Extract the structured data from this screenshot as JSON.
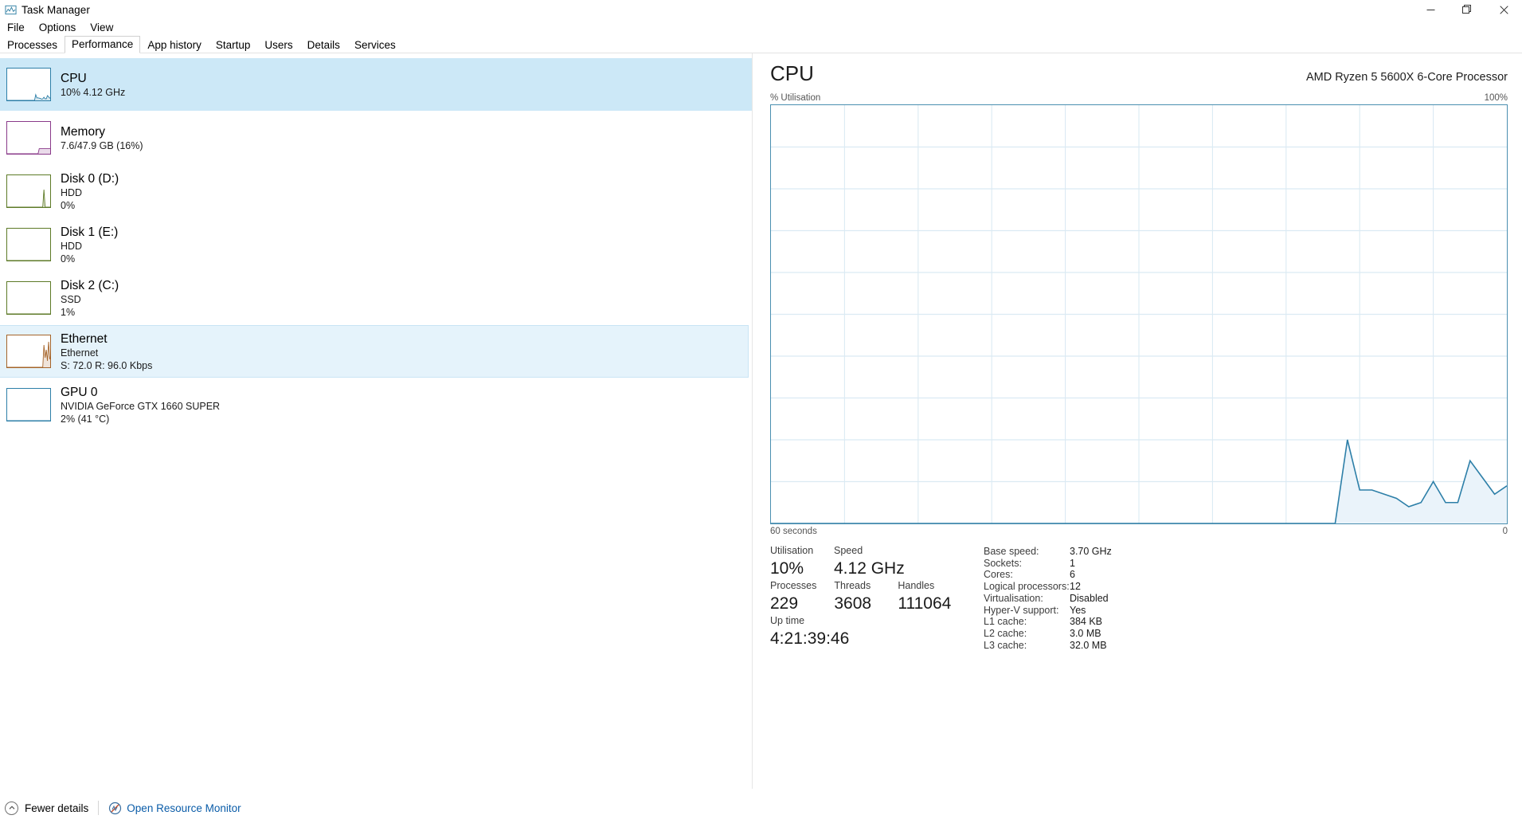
{
  "window": {
    "title": "Task Manager",
    "icon": "task-manager-icon",
    "minimize": "—",
    "restore": "❐",
    "close": "✕"
  },
  "menu": [
    "File",
    "Options",
    "View"
  ],
  "tabs": [
    {
      "label": "Processes",
      "active": false
    },
    {
      "label": "Performance",
      "active": true
    },
    {
      "label": "App history",
      "active": false
    },
    {
      "label": "Startup",
      "active": false
    },
    {
      "label": "Users",
      "active": false
    },
    {
      "label": "Details",
      "active": false
    },
    {
      "label": "Services",
      "active": false
    }
  ],
  "sidebar": {
    "items": [
      {
        "name": "cpu",
        "title": "CPU",
        "sub1": "10%  4.12 GHz",
        "sub2": "",
        "state": "selected",
        "color": "#2d7fa8"
      },
      {
        "name": "memory",
        "title": "Memory",
        "sub1": "7.6/47.9 GB (16%)",
        "sub2": "",
        "state": "normal",
        "color": "#8a3a8a"
      },
      {
        "name": "disk-0",
        "title": "Disk 0 (D:)",
        "sub1": "HDD",
        "sub2": "0%",
        "state": "normal",
        "color": "#5d7a27"
      },
      {
        "name": "disk-1",
        "title": "Disk 1 (E:)",
        "sub1": "HDD",
        "sub2": "0%",
        "state": "normal",
        "color": "#5d7a27"
      },
      {
        "name": "disk-2",
        "title": "Disk 2 (C:)",
        "sub1": "SSD",
        "sub2": "1%",
        "state": "normal",
        "color": "#5d7a27"
      },
      {
        "name": "ethernet",
        "title": "Ethernet",
        "sub1": "Ethernet",
        "sub2": "S: 72.0 R: 96.0 Kbps",
        "state": "hover",
        "color": "#a5642a"
      },
      {
        "name": "gpu-0",
        "title": "GPU 0",
        "sub1": "NVIDIA GeForce GTX 1660 SUPER",
        "sub2": "2%  (41 °C)",
        "state": "normal",
        "color": "#2d7fa8"
      }
    ]
  },
  "detail": {
    "title": "CPU",
    "model": "AMD Ryzen 5 5600X 6-Core Processor",
    "axis_top_left": "% Utilisation",
    "axis_top_right": "100%",
    "axis_bottom_left": "60 seconds",
    "axis_bottom_right": "0",
    "accent": "#2d7fa8",
    "fill": "#eaf3fa",
    "grid": "#dbeaf3",
    "stats": {
      "utilisation_label": "Utilisation",
      "utilisation_value": "10%",
      "speed_label": "Speed",
      "speed_value": "4.12 GHz",
      "processes_label": "Processes",
      "processes_value": "229",
      "threads_label": "Threads",
      "threads_value": "3608",
      "handles_label": "Handles",
      "handles_value": "111064",
      "uptime_label": "Up time",
      "uptime_value": "4:21:39:46"
    },
    "info": [
      {
        "key": "Base speed:",
        "value": "3.70 GHz"
      },
      {
        "key": "Sockets:",
        "value": "1"
      },
      {
        "key": "Cores:",
        "value": "6"
      },
      {
        "key": "Logical processors:",
        "value": "12"
      },
      {
        "key": "Virtualisation:",
        "value": "Disabled"
      },
      {
        "key": "Hyper-V support:",
        "value": "Yes"
      },
      {
        "key": "L1 cache:",
        "value": "384 KB"
      },
      {
        "key": "L2 cache:",
        "value": "3.0 MB"
      },
      {
        "key": "L3 cache:",
        "value": "32.0 MB"
      }
    ]
  },
  "statusbar": {
    "fewer_details": "Fewer details",
    "fewer_details_icon": "chevron-up-circle-icon",
    "resource_monitor": "Open Resource Monitor",
    "resource_monitor_icon": "resource-monitor-icon"
  },
  "chart_data": {
    "type": "area",
    "title": "CPU % Utilisation",
    "xlabel": "60 seconds",
    "ylabel": "% Utilisation",
    "ylim": [
      0,
      100
    ],
    "xlim": [
      0,
      60
    ],
    "grid": true,
    "legend": "none",
    "series": [
      {
        "name": "% Utilisation",
        "color": "#2d7fa8",
        "x": [
          0,
          1,
          2,
          3,
          4,
          5,
          6,
          7,
          8,
          9,
          10,
          11,
          12,
          13,
          14,
          15,
          16,
          17,
          18,
          19,
          20,
          21,
          22,
          23,
          24,
          25,
          26,
          27,
          28,
          29,
          30,
          31,
          32,
          33,
          34,
          35,
          36,
          37,
          38,
          39,
          40,
          41,
          42,
          43,
          44,
          45,
          46,
          47,
          48,
          49,
          50,
          51,
          52,
          53,
          54,
          55,
          56,
          57,
          58,
          59,
          60
        ],
        "values": [
          0,
          0,
          0,
          0,
          0,
          0,
          0,
          0,
          0,
          0,
          0,
          0,
          0,
          0,
          0,
          0,
          0,
          0,
          0,
          0,
          0,
          0,
          0,
          0,
          0,
          0,
          0,
          0,
          0,
          0,
          0,
          0,
          0,
          0,
          0,
          0,
          0,
          0,
          0,
          0,
          0,
          0,
          0,
          0,
          0,
          0,
          0,
          20,
          8,
          8,
          7,
          6,
          4,
          5,
          10,
          5,
          5,
          15,
          11,
          7,
          9
        ]
      }
    ],
    "thumbnails": [
      {
        "name": "cpu",
        "color": "#2d7fa8",
        "values": [
          0,
          0,
          0,
          0,
          0,
          0,
          0,
          0,
          0,
          0,
          0,
          0,
          0,
          0,
          0,
          0,
          0,
          0,
          0,
          0,
          0,
          0,
          0,
          0,
          0,
          18,
          8,
          8,
          7,
          6,
          4,
          5,
          10,
          5,
          5,
          15,
          11,
          7,
          9
        ]
      },
      {
        "name": "memory",
        "color": "#8a3a8a",
        "values": [
          0,
          0,
          0,
          0,
          0,
          0,
          0,
          0,
          0,
          0,
          0,
          0,
          0,
          0,
          0,
          0,
          0,
          0,
          0,
          0,
          0,
          0,
          0,
          0,
          0,
          0,
          0,
          0,
          16,
          16,
          16,
          16,
          16,
          16,
          16,
          16,
          16,
          16,
          16
        ]
      },
      {
        "name": "disk-0",
        "color": "#5d7a27",
        "values": [
          0,
          0,
          0,
          0,
          0,
          0,
          0,
          0,
          0,
          0,
          0,
          0,
          0,
          0,
          0,
          0,
          0,
          0,
          0,
          0,
          0,
          0,
          0,
          0,
          0,
          0,
          0,
          0,
          0,
          0,
          0,
          0,
          55,
          0,
          0,
          0,
          0,
          0,
          0
        ]
      },
      {
        "name": "disk-1",
        "color": "#5d7a27",
        "values": [
          0,
          0,
          0,
          0,
          0,
          0,
          0,
          0,
          0,
          0,
          0,
          0,
          0,
          0,
          0,
          0,
          0,
          0,
          0,
          0,
          0,
          0,
          0,
          0,
          0,
          0,
          0,
          0,
          0,
          0,
          0,
          0,
          0,
          0,
          0,
          0,
          0,
          0,
          0
        ]
      },
      {
        "name": "disk-2",
        "color": "#5d7a27",
        "values": [
          0,
          0,
          0,
          0,
          0,
          0,
          0,
          0,
          0,
          0,
          0,
          0,
          0,
          0,
          0,
          0,
          0,
          0,
          0,
          0,
          0,
          0,
          0,
          0,
          0,
          0,
          0,
          0,
          0,
          0,
          0,
          0,
          0,
          0,
          0,
          0,
          0,
          0,
          0
        ]
      },
      {
        "name": "ethernet",
        "color": "#a5642a",
        "values": [
          0,
          0,
          0,
          0,
          0,
          0,
          0,
          0,
          0,
          0,
          0,
          0,
          0,
          0,
          0,
          0,
          0,
          0,
          0,
          0,
          0,
          0,
          0,
          0,
          0,
          0,
          0,
          0,
          0,
          0,
          0,
          0,
          70,
          30,
          55,
          20,
          80,
          25,
          40
        ]
      },
      {
        "name": "gpu-0",
        "color": "#2d7fa8",
        "values": [
          0,
          0,
          0,
          0,
          0,
          0,
          0,
          0,
          0,
          0,
          0,
          0,
          0,
          0,
          0,
          0,
          0,
          0,
          0,
          0,
          0,
          0,
          0,
          0,
          0,
          0,
          0,
          0,
          0,
          0,
          0,
          0,
          0,
          0,
          0,
          0,
          0,
          0,
          0
        ]
      }
    ]
  }
}
